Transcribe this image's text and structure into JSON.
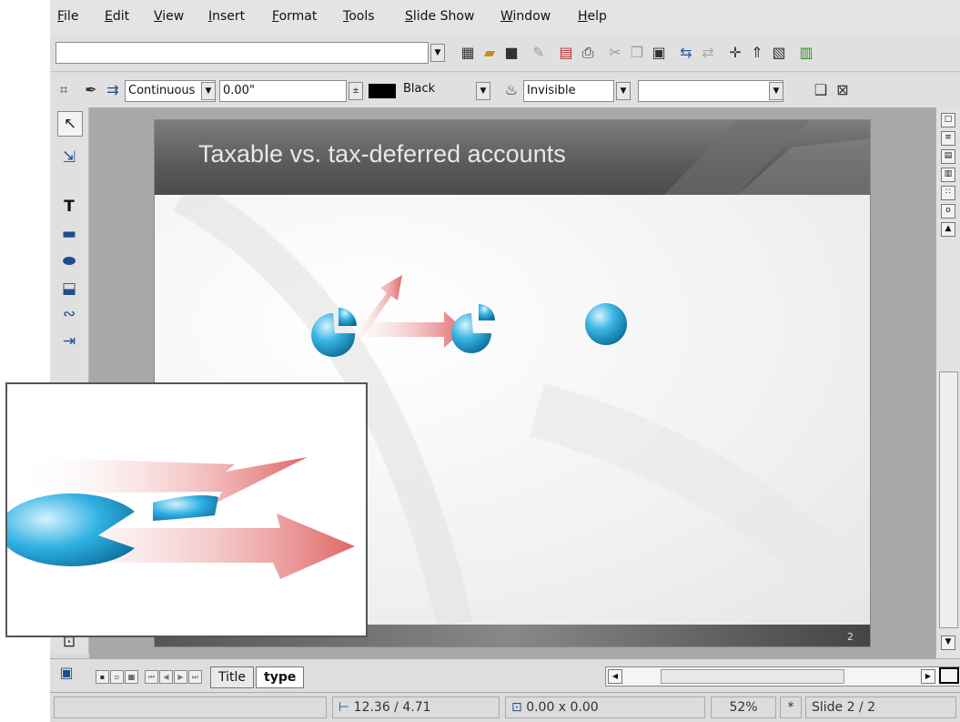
{
  "menu": [
    "File",
    "Edit",
    "View",
    "Insert",
    "Format",
    "Tools",
    "Slide Show",
    "Window",
    "Help"
  ],
  "toolbar": {
    "url_value": "",
    "line_style": "Continuous",
    "line_width": "0.00\"",
    "line_color": "Black",
    "area_style": "Invisible",
    "area_fill": ""
  },
  "slide": {
    "title": "Taxable vs. tax-deferred accounts",
    "number": "2"
  },
  "tabs": [
    "Title",
    "type"
  ],
  "status": {
    "position": "12.36 / 4.71",
    "size": "0.00 x 0.00",
    "zoom": "52%",
    "marker": "*",
    "page": "Slide 2 / 2"
  },
  "colors": {
    "accent_blue": "#2aa7d8",
    "arrow_red": "#e27a7a",
    "title_bar": "#5a5a5a"
  }
}
